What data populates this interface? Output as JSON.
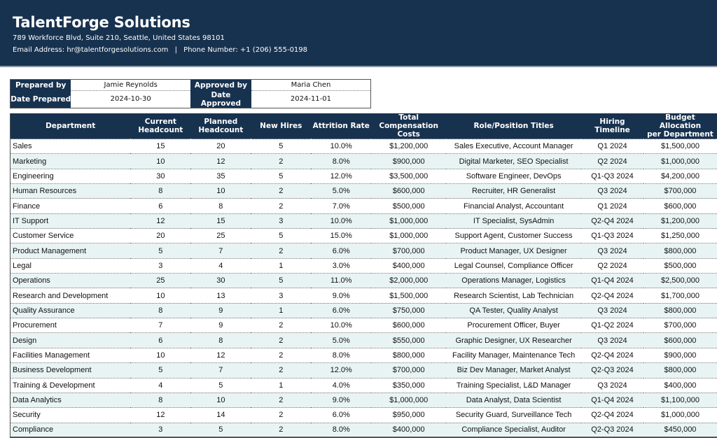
{
  "company": {
    "name": "TalentForge Solutions",
    "address": "789 Workforce Blvd, Suite 210, Seattle, United States 98101",
    "email_label": "Email Address:",
    "email": "hr@talentforgesolutions.com",
    "separator": "|",
    "phone_label": "Phone Number:",
    "phone": "+1 (206) 555-0198"
  },
  "approval": {
    "prepared_by_label": "Prepared by",
    "prepared_by": "Jamie Reynolds",
    "date_prepared_label": "Date Prepared",
    "date_prepared": "2024-10-30",
    "approved_by_label": "Approved by",
    "approved_by": "Maria Chen",
    "date_approved_label": "Date Approved",
    "date_approved": "2024-11-01"
  },
  "table": {
    "headers": {
      "department": "Department",
      "current_1": "Current",
      "current_2": "Headcount",
      "planned_1": "Planned",
      "planned_2": "Headcount",
      "new_hires": "New Hires",
      "attrition": "Attrition Rate",
      "comp_1": "Total Compensation",
      "comp_2": "Costs",
      "roles": "Role/Position Titles",
      "timeline": "Hiring Timeline",
      "budget_1": "Budget Allocation",
      "budget_2": "per Department"
    },
    "rows": [
      [
        "Sales",
        "15",
        "20",
        "5",
        "10.0%",
        "$1,200,000",
        "Sales Executive, Account Manager",
        "Q1 2024",
        "$1,500,000"
      ],
      [
        "Marketing",
        "10",
        "12",
        "2",
        "8.0%",
        "$900,000",
        "Digital Marketer, SEO Specialist",
        "Q2 2024",
        "$1,000,000"
      ],
      [
        "Engineering",
        "30",
        "35",
        "5",
        "12.0%",
        "$3,500,000",
        "Software Engineer, DevOps",
        "Q1-Q3 2024",
        "$4,200,000"
      ],
      [
        "Human Resources",
        "8",
        "10",
        "2",
        "5.0%",
        "$600,000",
        "Recruiter, HR Generalist",
        "Q3 2024",
        "$700,000"
      ],
      [
        "Finance",
        "6",
        "8",
        "2",
        "7.0%",
        "$500,000",
        "Financial Analyst, Accountant",
        "Q1 2024",
        "$600,000"
      ],
      [
        "IT Support",
        "12",
        "15",
        "3",
        "10.0%",
        "$1,000,000",
        "IT Specialist, SysAdmin",
        "Q2-Q4 2024",
        "$1,200,000"
      ],
      [
        "Customer Service",
        "20",
        "25",
        "5",
        "15.0%",
        "$1,000,000",
        "Support Agent, Customer Success",
        "Q1-Q3 2024",
        "$1,250,000"
      ],
      [
        "Product Management",
        "5",
        "7",
        "2",
        "6.0%",
        "$700,000",
        "Product Manager, UX Designer",
        "Q3 2024",
        "$800,000"
      ],
      [
        "Legal",
        "3",
        "4",
        "1",
        "3.0%",
        "$400,000",
        "Legal Counsel, Compliance Officer",
        "Q2 2024",
        "$500,000"
      ],
      [
        "Operations",
        "25",
        "30",
        "5",
        "11.0%",
        "$2,000,000",
        "Operations Manager, Logistics",
        "Q1-Q4 2024",
        "$2,500,000"
      ],
      [
        "Research and Development",
        "10",
        "13",
        "3",
        "9.0%",
        "$1,500,000",
        "Research Scientist, Lab Technician",
        "Q2-Q4 2024",
        "$1,700,000"
      ],
      [
        "Quality Assurance",
        "8",
        "9",
        "1",
        "6.0%",
        "$750,000",
        "QA Tester, Quality Analyst",
        "Q3 2024",
        "$800,000"
      ],
      [
        "Procurement",
        "7",
        "9",
        "2",
        "10.0%",
        "$600,000",
        "Procurement Officer, Buyer",
        "Q1-Q2 2024",
        "$700,000"
      ],
      [
        "Design",
        "6",
        "8",
        "2",
        "5.0%",
        "$550,000",
        "Graphic Designer, UX Researcher",
        "Q3 2024",
        "$600,000"
      ],
      [
        "Facilities Management",
        "10",
        "12",
        "2",
        "8.0%",
        "$800,000",
        "Facility Manager, Maintenance Tech",
        "Q2-Q4 2024",
        "$900,000"
      ],
      [
        "Business Development",
        "5",
        "7",
        "2",
        "12.0%",
        "$700,000",
        "Biz Dev Manager, Market Analyst",
        "Q2-Q3 2024",
        "$800,000"
      ],
      [
        "Training & Development",
        "4",
        "5",
        "1",
        "4.0%",
        "$350,000",
        "Training Specialist, L&D Manager",
        "Q3 2024",
        "$400,000"
      ],
      [
        "Data Analytics",
        "8",
        "10",
        "2",
        "9.0%",
        "$1,000,000",
        "Data Analyst, Data Scientist",
        "Q1-Q4 2024",
        "$1,100,000"
      ],
      [
        "Security",
        "12",
        "14",
        "2",
        "6.0%",
        "$950,000",
        "Security Guard, Surveillance Tech",
        "Q2-Q4 2024",
        "$1,000,000"
      ],
      [
        "Compliance",
        "3",
        "5",
        "2",
        "8.0%",
        "$400,000",
        "Compliance Specialist, Auditor",
        "Q2-Q3 2024",
        "$450,000"
      ]
    ]
  }
}
